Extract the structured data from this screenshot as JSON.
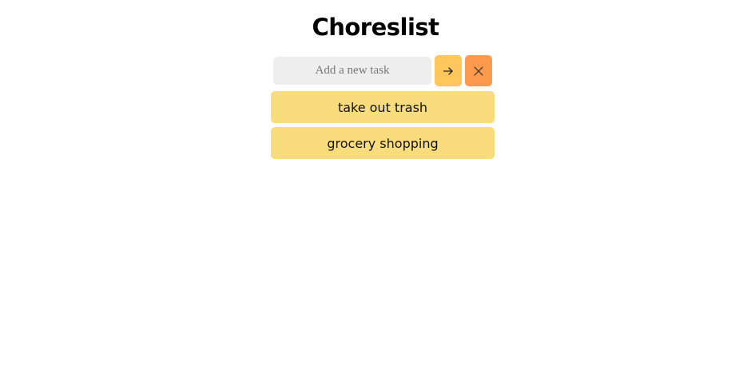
{
  "app": {
    "title": "Choreslist"
  },
  "form": {
    "input_value": "",
    "input_placeholder": "Add a new task",
    "add_button_icon": "arrow-right-icon",
    "clear_button_icon": "close-icon"
  },
  "tasks": [
    {
      "label": "take out trash"
    },
    {
      "label": "grocery shopping"
    }
  ],
  "colors": {
    "background": "#ffffff",
    "input_background": "#eeeeee",
    "add_button": "#ffc65c",
    "clear_button": "#ff9a4d",
    "task_item": "#f9dc7c"
  }
}
